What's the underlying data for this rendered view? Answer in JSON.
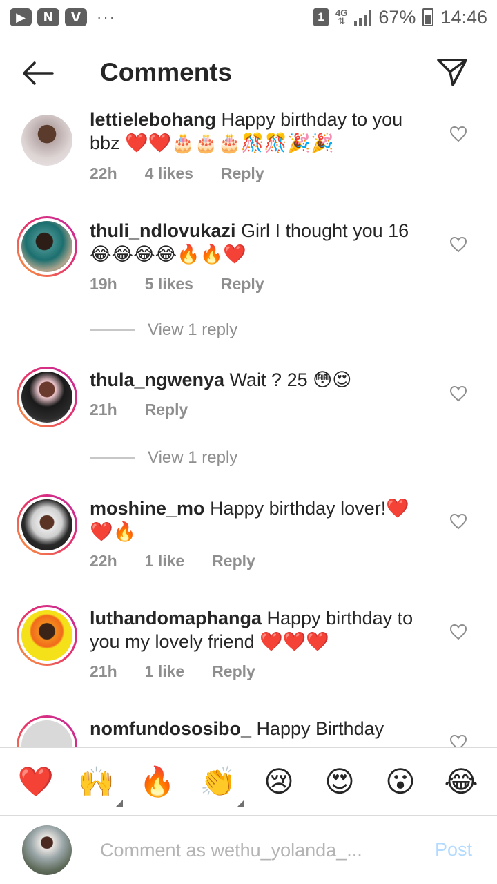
{
  "status_bar": {
    "app_icons": [
      "▶",
      "N",
      "V"
    ],
    "dots": "···",
    "sim_badge": "1",
    "network_top": "4G",
    "network_bottom": "⇅",
    "battery": "67%",
    "time": "14:46"
  },
  "header": {
    "title": "Comments"
  },
  "comments": [
    {
      "username": "lettielebohang",
      "text": "Happy birthday to you bbz ❤️❤️🎂🎂🎂🎊🎊🎉🎉",
      "time": "22h",
      "likes": "4 likes",
      "reply": "Reply",
      "view_replies": ""
    },
    {
      "username": "thuli_ndlovukazi",
      "text": "Girl I thought you 16😂😂😂😂🔥🔥❤️",
      "time": "19h",
      "likes": "5 likes",
      "reply": "Reply",
      "view_replies": "View 1 reply"
    },
    {
      "username": "thula_ngwenya",
      "text": "Wait ? 25 😳😍",
      "time": "21h",
      "likes": "",
      "reply": "Reply",
      "view_replies": "View 1 reply"
    },
    {
      "username": "moshine_mo",
      "text": "Happy birthday lover!❤️❤️🔥",
      "time": "22h",
      "likes": "1 like",
      "reply": "Reply",
      "view_replies": ""
    },
    {
      "username": "luthandomaphanga",
      "text": "Happy birthday to you my lovely friend ❤️❤️❤️",
      "time": "21h",
      "likes": "1 like",
      "reply": "Reply",
      "view_replies": ""
    },
    {
      "username": "nomfundososibo_",
      "text": "Happy Birthday",
      "time": "",
      "likes": "",
      "reply": "",
      "view_replies": ""
    }
  ],
  "emoji_bar": [
    "❤️",
    "🙌",
    "🔥",
    "👏",
    "😢",
    "😍",
    "😮",
    "😂"
  ],
  "composer": {
    "placeholder": "Comment as wethu_yolanda_...",
    "post_label": "Post"
  },
  "colors": {
    "text": "#262626",
    "meta": "#8e8e8e",
    "post_disabled": "#b3dbff",
    "story_ring_start": "#f9a53a",
    "story_ring_end": "#c02aa0"
  }
}
